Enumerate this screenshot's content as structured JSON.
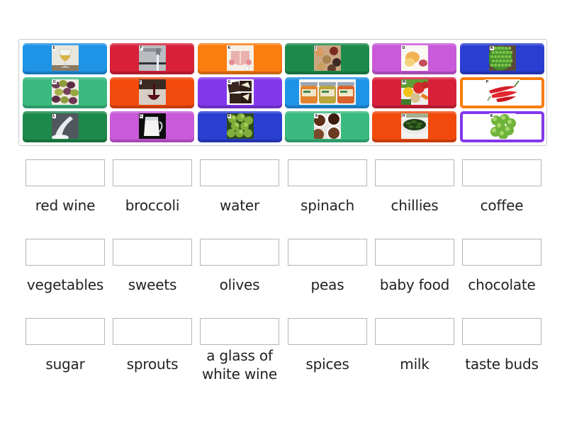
{
  "tiles": [
    {
      "letter": "E",
      "depicts": "glass of white wine",
      "color": "#1f93e6",
      "style": "filled",
      "pic": "white-wine"
    },
    {
      "letter": "F",
      "depicts": "tap water",
      "color": "#d8203a",
      "style": "filled",
      "pic": "water"
    },
    {
      "letter": "K",
      "depicts": "tongue taste buds diagram",
      "color": "#fb7c0f",
      "style": "filled",
      "pic": "tongue"
    },
    {
      "letter": "J",
      "depicts": "spices",
      "color": "#1d8a4b",
      "style": "filled",
      "pic": "spices"
    },
    {
      "letter": "D",
      "depicts": "sweets",
      "color": "#c95ad9",
      "style": "filled",
      "pic": "sweets"
    },
    {
      "letter": "N",
      "depicts": "peas",
      "color": "#2a3fd2",
      "style": "filled",
      "pic": "peas"
    },
    {
      "letter": "O",
      "depicts": "olives",
      "color": "#3aba7f",
      "style": "filled",
      "pic": "olives"
    },
    {
      "letter": "I",
      "depicts": "red wine",
      "color": "#f24a0c",
      "style": "filled",
      "pic": "red-wine"
    },
    {
      "letter": "G",
      "depicts": "chocolate",
      "color": "#8338ec",
      "style": "filled",
      "pic": "chocolate"
    },
    {
      "letter": "",
      "depicts": "baby food jars",
      "color": "#1f93e6",
      "style": "filled",
      "pic": "babyfood"
    },
    {
      "letter": "M",
      "depicts": "vegetables",
      "color": "#d8203a",
      "style": "filled",
      "pic": "vegetables"
    },
    {
      "letter": "P",
      "depicts": "chillies",
      "color": "#fb7c0f",
      "style": "outlined",
      "pic": "chillies"
    },
    {
      "letter": "L",
      "depicts": "sugar",
      "color": "#1d8a4b",
      "style": "filled",
      "pic": "sugar"
    },
    {
      "letter": "C",
      "depicts": "milk",
      "color": "#c95ad9",
      "style": "filled",
      "pic": "milk"
    },
    {
      "letter": "K",
      "depicts": "broccoli",
      "color": "#2a3fd2",
      "style": "filled",
      "pic": "broccoli"
    },
    {
      "letter": "A",
      "depicts": "coffee",
      "color": "#3aba7f",
      "style": "filled",
      "pic": "coffee"
    },
    {
      "letter": "H",
      "depicts": "spinach",
      "color": "#f24a0c",
      "style": "filled",
      "pic": "spinach"
    },
    {
      "letter": "B",
      "depicts": "sprouts",
      "color": "#8338ec",
      "style": "outlined",
      "pic": "sprouts"
    }
  ],
  "targets": [
    {
      "label": "red wine",
      "answer": ""
    },
    {
      "label": "broccoli",
      "answer": ""
    },
    {
      "label": "water",
      "answer": ""
    },
    {
      "label": "spinach",
      "answer": ""
    },
    {
      "label": "chillies",
      "answer": ""
    },
    {
      "label": "coffee",
      "answer": ""
    },
    {
      "label": "vegetables",
      "answer": ""
    },
    {
      "label": "sweets",
      "answer": ""
    },
    {
      "label": "olives",
      "answer": ""
    },
    {
      "label": "peas",
      "answer": ""
    },
    {
      "label": "baby food",
      "answer": ""
    },
    {
      "label": "chocolate",
      "answer": ""
    },
    {
      "label": "sugar",
      "answer": ""
    },
    {
      "label": "sprouts",
      "answer": ""
    },
    {
      "label": "a glass of white wine",
      "answer": ""
    },
    {
      "label": "spices",
      "answer": ""
    },
    {
      "label": "milk",
      "answer": ""
    },
    {
      "label": "taste buds",
      "answer": ""
    }
  ]
}
